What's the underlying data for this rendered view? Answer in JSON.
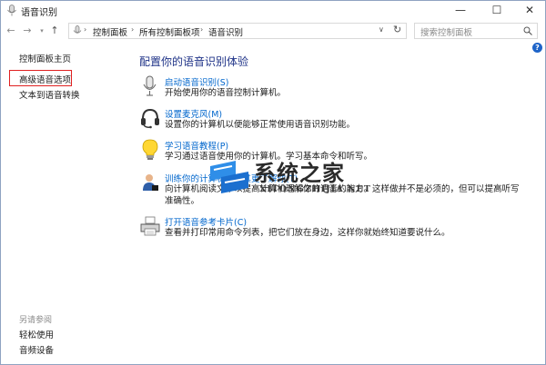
{
  "window": {
    "title": "语音识别"
  },
  "nav": {
    "breadcrumb": [
      "控制面板",
      "所有控制面板项",
      "语音识别"
    ],
    "search_placeholder": "搜索控制面板"
  },
  "left": {
    "home": "控制面板主页",
    "links": [
      "高级语音选项",
      "文本到语音转换"
    ],
    "see_also_header": "另请参阅",
    "see_also": [
      "轻松使用",
      "音频设备"
    ]
  },
  "main": {
    "title": "配置你的语音识别体验",
    "items": [
      {
        "icon": "microphone-icon",
        "link": "启动语音识别(S)",
        "desc": "开始使用你的语音控制计算机。"
      },
      {
        "icon": "headset-icon",
        "link": "设置麦克风(M)",
        "desc": "设置你的计算机以便能够正常使用语音识别功能。"
      },
      {
        "icon": "lightbulb-icon",
        "link": "学习语音教程(P)",
        "desc": "学习通过语音使用你的计算机。学习基本命令和听写。"
      },
      {
        "icon": "user-train-icon",
        "link": "训练你的计算机以使其更了解你(T)",
        "desc": "向计算机阅读文本以提高计算机理解你的语音的能力。这样做并不是必须的，但可以提高听写准确性。"
      },
      {
        "icon": "printer-icon",
        "link": "打开语音参考卡片(C)",
        "desc": "查看并打印常用命令列表，把它们放在身边，这样你就始终知道要说什么。"
      }
    ]
  },
  "watermark": {
    "cn": "系统之家",
    "en": "XITONGZHIJIA.NET"
  }
}
